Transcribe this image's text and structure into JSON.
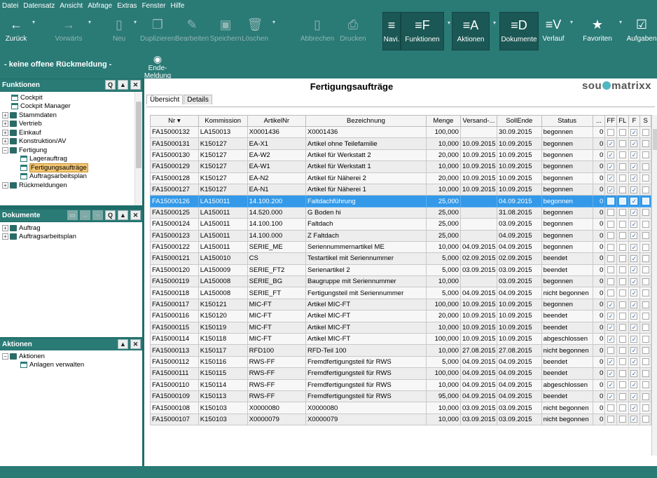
{
  "menu": [
    "Datei",
    "Datensatz",
    "Ansicht",
    "Abfrage",
    "Extras",
    "Fenster",
    "Hilfe"
  ],
  "toolbar": {
    "back": "Zurück",
    "forward": "Vorwärts",
    "new": "Neu",
    "duplicate": "Duplizieren",
    "edit": "Bearbeiten",
    "save": "Speichern",
    "delete": "Löschen",
    "cancel": "Abbrechen",
    "print": "Drucken",
    "navi": "Navi.",
    "functions": "Funktionen",
    "actions": "Aktionen",
    "documents": "Dokumente",
    "history": "Verlauf",
    "favorites": "Favoriten",
    "tasks": "Aufgaben"
  },
  "strip": {
    "feedback": "- keine offene Rückmeldung -",
    "end_report": "Ende-Meldung"
  },
  "panels": {
    "functions": {
      "title": "Funktionen",
      "items": [
        {
          "label": "Cockpit",
          "indent": 1,
          "type": "doc",
          "pm": ""
        },
        {
          "label": "Cockpit Manager",
          "indent": 1,
          "type": "doc",
          "pm": ""
        },
        {
          "label": "Stammdaten",
          "indent": 0,
          "type": "folder",
          "pm": "+"
        },
        {
          "label": "Vertrieb",
          "indent": 0,
          "type": "folder",
          "pm": "+"
        },
        {
          "label": "Einkauf",
          "indent": 0,
          "type": "folder",
          "pm": "+"
        },
        {
          "label": "Konstruktion/AV",
          "indent": 0,
          "type": "folder",
          "pm": "+"
        },
        {
          "label": "Fertigung",
          "indent": 0,
          "type": "folder",
          "pm": "−"
        },
        {
          "label": "Lagerauftrag",
          "indent": 2,
          "type": "doc",
          "pm": ""
        },
        {
          "label": "Fertigungsaufträge",
          "indent": 2,
          "type": "doc",
          "pm": "",
          "selected": true
        },
        {
          "label": "Auftragsarbeitsplan",
          "indent": 2,
          "type": "doc",
          "pm": ""
        },
        {
          "label": "Rückmeldungen",
          "indent": 0,
          "type": "folder",
          "pm": "+"
        }
      ]
    },
    "documents": {
      "title": "Dokumente",
      "items": [
        {
          "label": "Auftrag",
          "indent": 0,
          "type": "folder",
          "pm": "+"
        },
        {
          "label": "Auftragsarbeitsplan",
          "indent": 0,
          "type": "folder",
          "pm": "+"
        }
      ]
    },
    "actions": {
      "title": "Aktionen",
      "items": [
        {
          "label": "Aktionen",
          "indent": 0,
          "type": "folder",
          "pm": "−"
        },
        {
          "label": "Anlagen verwalten",
          "indent": 2,
          "type": "doc",
          "pm": ""
        }
      ]
    }
  },
  "main": {
    "title": "Fertigungsaufträge",
    "logo_left": "sou",
    "logo_right": "matrixx",
    "tabs": [
      "Übersicht",
      "Details"
    ],
    "columns": [
      "Nr ▾",
      "Kommission",
      "ArtikelNr",
      "Bezeichnung",
      "Menge",
      "Versand-...",
      "SollEnde",
      "Status",
      "...",
      "FF",
      "FL",
      "F",
      "S"
    ],
    "rows": [
      [
        "FA15000132",
        "LA150013",
        "X0001436",
        "X0001436",
        "100,000",
        "",
        "30.09.2015",
        "begonnen",
        "0",
        0,
        0,
        1,
        0
      ],
      [
        "FA15000131",
        "K150127",
        "EA-X1",
        "Artikel ohne Teilefamilie",
        "10,000",
        "10.09.2015",
        "10.09.2015",
        "begonnen",
        "0",
        1,
        0,
        1,
        0
      ],
      [
        "FA15000130",
        "K150127",
        "EA-W2",
        "Artikel für Werkstatt 2",
        "20,000",
        "10.09.2015",
        "10.09.2015",
        "begonnen",
        "0",
        1,
        0,
        1,
        0
      ],
      [
        "FA15000129",
        "K150127",
        "EA-W1",
        "Artikel für Werkstatt 1",
        "10,000",
        "10.09.2015",
        "10.09.2015",
        "begonnen",
        "0",
        1,
        0,
        1,
        0
      ],
      [
        "FA15000128",
        "K150127",
        "EA-N2",
        "Artikel für Näherei 2",
        "20,000",
        "10.09.2015",
        "10.09.2015",
        "begonnen",
        "0",
        1,
        0,
        1,
        0
      ],
      [
        "FA15000127",
        "K150127",
        "EA-N1",
        "Artikel für Näherei 1",
        "10,000",
        "10.09.2015",
        "10.09.2015",
        "begonnen",
        "0",
        1,
        0,
        1,
        0
      ],
      [
        "FA15000126",
        "LA150011",
        "14.100.200",
        "Faltdachführung",
        "25,000",
        "",
        "04.09.2015",
        "begonnen",
        "0",
        0,
        0,
        1,
        0
      ],
      [
        "FA15000125",
        "LA150011",
        "14.520.000",
        "G Boden hi",
        "25,000",
        "",
        "31.08.2015",
        "begonnen",
        "0",
        0,
        0,
        1,
        0
      ],
      [
        "FA15000124",
        "LA150011",
        "14.100.100",
        "Faltdach",
        "25,000",
        "",
        "03.09.2015",
        "begonnen",
        "0",
        0,
        0,
        1,
        0
      ],
      [
        "FA15000123",
        "LA150011",
        "14.100.000",
        "Z Faltdach",
        "25,000",
        "",
        "04.09.2015",
        "begonnen",
        "0",
        0,
        0,
        1,
        0
      ],
      [
        "FA15000122",
        "LA150011",
        "SERIE_ME",
        "Seriennummernartikel ME",
        "10,000",
        "04.09.2015",
        "04.09.2015",
        "begonnen",
        "0",
        0,
        0,
        1,
        0
      ],
      [
        "FA15000121",
        "LA150010",
        "CS",
        "Testartikel mit Seriennummer",
        "5,000",
        "02.09.2015",
        "02.09.2015",
        "beendet",
        "0",
        0,
        0,
        1,
        0
      ],
      [
        "FA15000120",
        "LA150009",
        "SERIE_FT2",
        "Serienartikel 2",
        "5,000",
        "03.09.2015",
        "03.09.2015",
        "beendet",
        "0",
        0,
        0,
        1,
        0
      ],
      [
        "FA15000119",
        "LA150008",
        "SERIE_BG",
        "Baugruppe mit Seriennummer",
        "10,000",
        "",
        "03.09.2015",
        "begonnen",
        "0",
        0,
        0,
        1,
        0
      ],
      [
        "FA15000118",
        "LA150008",
        "SERIE_FT",
        "Fertigungsteil mit Seriennummer",
        "5,000",
        "04.09.2015",
        "04.09.2015",
        "nicht begonnen",
        "0",
        0,
        0,
        1,
        0
      ],
      [
        "FA15000117",
        "K150121",
        "MIC-FT",
        "Artikel MIC-FT",
        "100,000",
        "10.09.2015",
        "10.09.2015",
        "begonnen",
        "0",
        1,
        0,
        1,
        0
      ],
      [
        "FA15000116",
        "K150120",
        "MIC-FT",
        "Artikel MIC-FT",
        "20,000",
        "10.09.2015",
        "10.09.2015",
        "beendet",
        "0",
        1,
        0,
        1,
        0
      ],
      [
        "FA15000115",
        "K150119",
        "MIC-FT",
        "Artikel MIC-FT",
        "10,000",
        "10.09.2015",
        "10.09.2015",
        "beendet",
        "0",
        1,
        0,
        1,
        0
      ],
      [
        "FA15000114",
        "K150118",
        "MIC-FT",
        "Artikel MIC-FT",
        "100,000",
        "10.09.2015",
        "10.09.2015",
        "abgeschlossen",
        "0",
        1,
        0,
        1,
        0
      ],
      [
        "FA15000113",
        "K150117",
        "RFD100",
        "RFD-Teil 100",
        "10,000",
        "27.08.2015",
        "27.08.2015",
        "nicht begonnen",
        "0",
        0,
        0,
        1,
        0
      ],
      [
        "FA15000112",
        "K150116",
        "RWS-FF",
        "Fremdfertigungsteil für RWS",
        "5,000",
        "04.09.2015",
        "04.09.2015",
        "beendet",
        "0",
        1,
        0,
        1,
        0
      ],
      [
        "FA15000111",
        "K150115",
        "RWS-FF",
        "Fremdfertigungsteil für RWS",
        "100,000",
        "04.09.2015",
        "04.09.2015",
        "beendet",
        "0",
        1,
        0,
        1,
        0
      ],
      [
        "FA15000110",
        "K150114",
        "RWS-FF",
        "Fremdfertigungsteil für RWS",
        "10,000",
        "04.09.2015",
        "04.09.2015",
        "abgeschlossen",
        "0",
        1,
        0,
        1,
        0
      ],
      [
        "FA15000109",
        "K150113",
        "RWS-FF",
        "Fremdfertigungsteil für RWS",
        "95,000",
        "04.09.2015",
        "04.09.2015",
        "beendet",
        "0",
        1,
        0,
        1,
        0
      ],
      [
        "FA15000108",
        "K150103",
        "X0000080",
        "X0000080",
        "10,000",
        "03.09.2015",
        "03.09.2015",
        "nicht begonnen",
        "0",
        0,
        0,
        1,
        0
      ],
      [
        "FA15000107",
        "K150103",
        "X0000079",
        "X0000079",
        "10,000",
        "03.09.2015",
        "03.09.2015",
        "nicht begonnen",
        "0",
        0,
        0,
        1,
        0
      ]
    ],
    "selected_row": 6
  }
}
